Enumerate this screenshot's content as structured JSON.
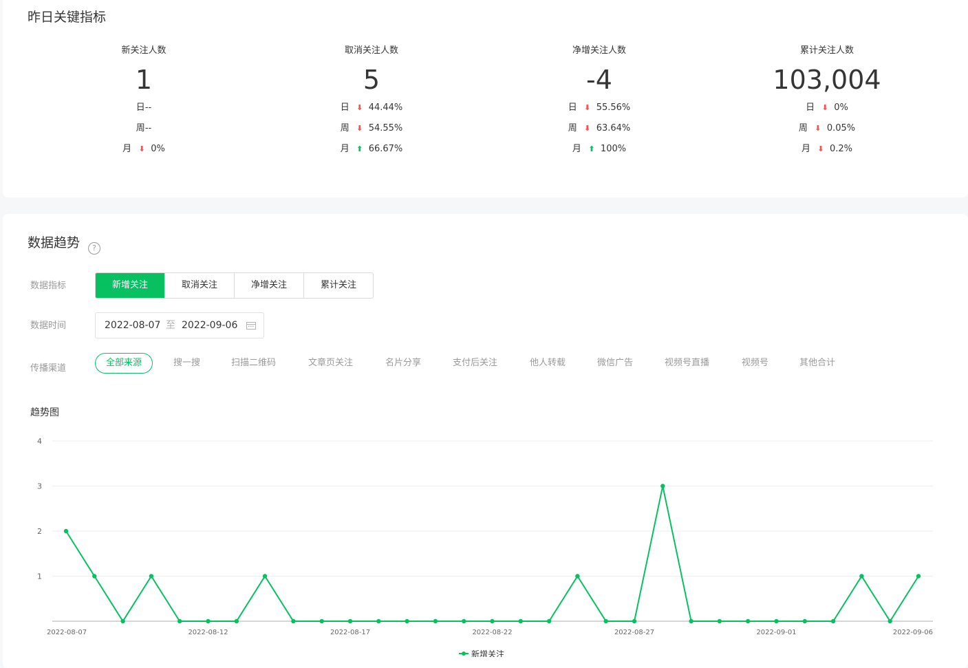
{
  "kpi": {
    "title": "昨日关键指标",
    "cards": [
      {
        "label": "新关注人数",
        "value": "1",
        "day": {
          "prefix": "日",
          "text": "--",
          "arrow": ""
        },
        "week": {
          "prefix": "周",
          "text": "--",
          "arrow": ""
        },
        "month": {
          "prefix": "月",
          "text": "0%",
          "arrow": "down"
        }
      },
      {
        "label": "取消关注人数",
        "value": "5",
        "day": {
          "prefix": "日",
          "text": "44.44%",
          "arrow": "down"
        },
        "week": {
          "prefix": "周",
          "text": "54.55%",
          "arrow": "down"
        },
        "month": {
          "prefix": "月",
          "text": "66.67%",
          "arrow": "up"
        }
      },
      {
        "label": "净增关注人数",
        "value": "-4",
        "day": {
          "prefix": "日",
          "text": "55.56%",
          "arrow": "down"
        },
        "week": {
          "prefix": "周",
          "text": "63.64%",
          "arrow": "down"
        },
        "month": {
          "prefix": "月",
          "text": "100%",
          "arrow": "up"
        }
      },
      {
        "label": "累计关注人数",
        "value": "103,004",
        "day": {
          "prefix": "日",
          "text": "0%",
          "arrow": "down"
        },
        "week": {
          "prefix": "周",
          "text": "0.05%",
          "arrow": "down"
        },
        "month": {
          "prefix": "月",
          "text": "0.2%",
          "arrow": "down"
        }
      }
    ]
  },
  "trend": {
    "title": "数据趋势",
    "help_icon": "question-circle-icon",
    "metric_label": "数据指标",
    "metrics": [
      "新增关注",
      "取消关注",
      "净增关注",
      "累计关注"
    ],
    "metric_selected": "新增关注",
    "time_label": "数据时间",
    "date_start": "2022-08-07",
    "date_sep": "至",
    "date_end": "2022-09-06",
    "calendar_icon": "calendar-icon",
    "channel_label": "传播渠道",
    "channels": [
      "全部来源",
      "搜一搜",
      "扫描二维码",
      "文章页关注",
      "名片分享",
      "支付后关注",
      "他人转载",
      "微信广告",
      "视频号直播",
      "视频号",
      "其他合计"
    ],
    "channel_selected": "全部来源",
    "chart_title": "趋势图"
  },
  "colors": {
    "accent": "#07c160",
    "down": "#fa5151",
    "up": "#07c160"
  },
  "chart_data": {
    "type": "line",
    "x": [
      "2022-08-07",
      "2022-08-08",
      "2022-08-09",
      "2022-08-10",
      "2022-08-11",
      "2022-08-12",
      "2022-08-13",
      "2022-08-14",
      "2022-08-15",
      "2022-08-16",
      "2022-08-17",
      "2022-08-18",
      "2022-08-19",
      "2022-08-20",
      "2022-08-21",
      "2022-08-22",
      "2022-08-23",
      "2022-08-24",
      "2022-08-25",
      "2022-08-26",
      "2022-08-27",
      "2022-08-28",
      "2022-08-29",
      "2022-08-30",
      "2022-08-31",
      "2022-09-01",
      "2022-09-02",
      "2022-09-03",
      "2022-09-04",
      "2022-09-05",
      "2022-09-06"
    ],
    "x_tick_labels": [
      "2022-08-07",
      "2022-08-12",
      "2022-08-17",
      "2022-08-22",
      "2022-08-27",
      "2022-09-01",
      "2022-09-06"
    ],
    "series": [
      {
        "name": "新增关注",
        "color": "#07c160",
        "values": [
          2,
          1,
          0,
          1,
          0,
          0,
          0,
          1,
          0,
          0,
          0,
          0,
          0,
          0,
          0,
          0,
          0,
          0,
          1,
          0,
          0,
          3,
          0,
          0,
          0,
          0,
          0,
          0,
          1,
          0,
          1
        ]
      }
    ],
    "yticks": [
      1,
      2,
      3,
      4
    ],
    "ylim": [
      0,
      4
    ],
    "grid": true,
    "legend_position": "bottom-center"
  }
}
